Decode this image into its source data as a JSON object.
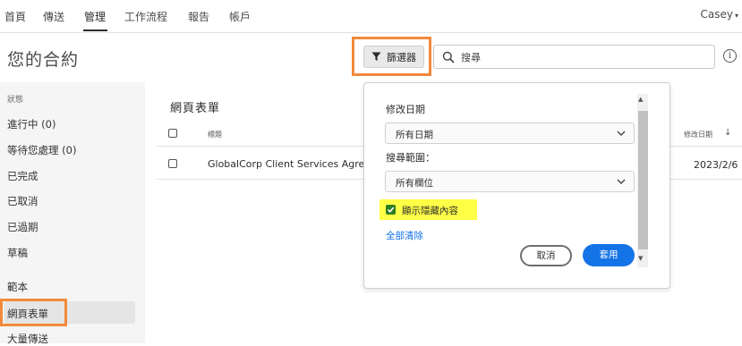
{
  "nav": {
    "items": [
      "首頁",
      "傳送",
      "管理",
      "工作流程",
      "報告",
      "帳戶"
    ],
    "active": "管理",
    "user": "Casey"
  },
  "header": {
    "title": "您的合約",
    "filter_label": "篩選器",
    "search_placeholder": "搜尋"
  },
  "sidebar": {
    "heading": "狀態",
    "status_items": [
      "進行中 (0)",
      "等待您處理 (0)",
      "已完成",
      "已取消",
      "已過期",
      "草稿"
    ],
    "other_items": [
      "範本",
      "網頁表單",
      "大量傳送"
    ],
    "selected": "網頁表單"
  },
  "main": {
    "title": "網頁表單",
    "col_title": "標題",
    "col_date": "修改日期",
    "sort_icon": "arrow-down-icon",
    "rows": [
      {
        "name": "GlobalCorp Client Services Agreement",
        "date": "2023/2/6"
      }
    ]
  },
  "filter_panel": {
    "modified_label": "修改日期",
    "modified_value": "所有日期",
    "scope_label": "搜尋範圍：",
    "scope_value": "所有欄位",
    "show_hidden_label": "顯示隱藏內容",
    "show_hidden_checked": true,
    "clear_all": "全部清除",
    "cancel": "取消",
    "apply": "套用"
  },
  "colors": {
    "accent_blue": "#1473e6",
    "highlight_orange": "#f28a3b",
    "highlight_yellow": "#ffff47",
    "checkbox_green": "#2d7d21"
  }
}
